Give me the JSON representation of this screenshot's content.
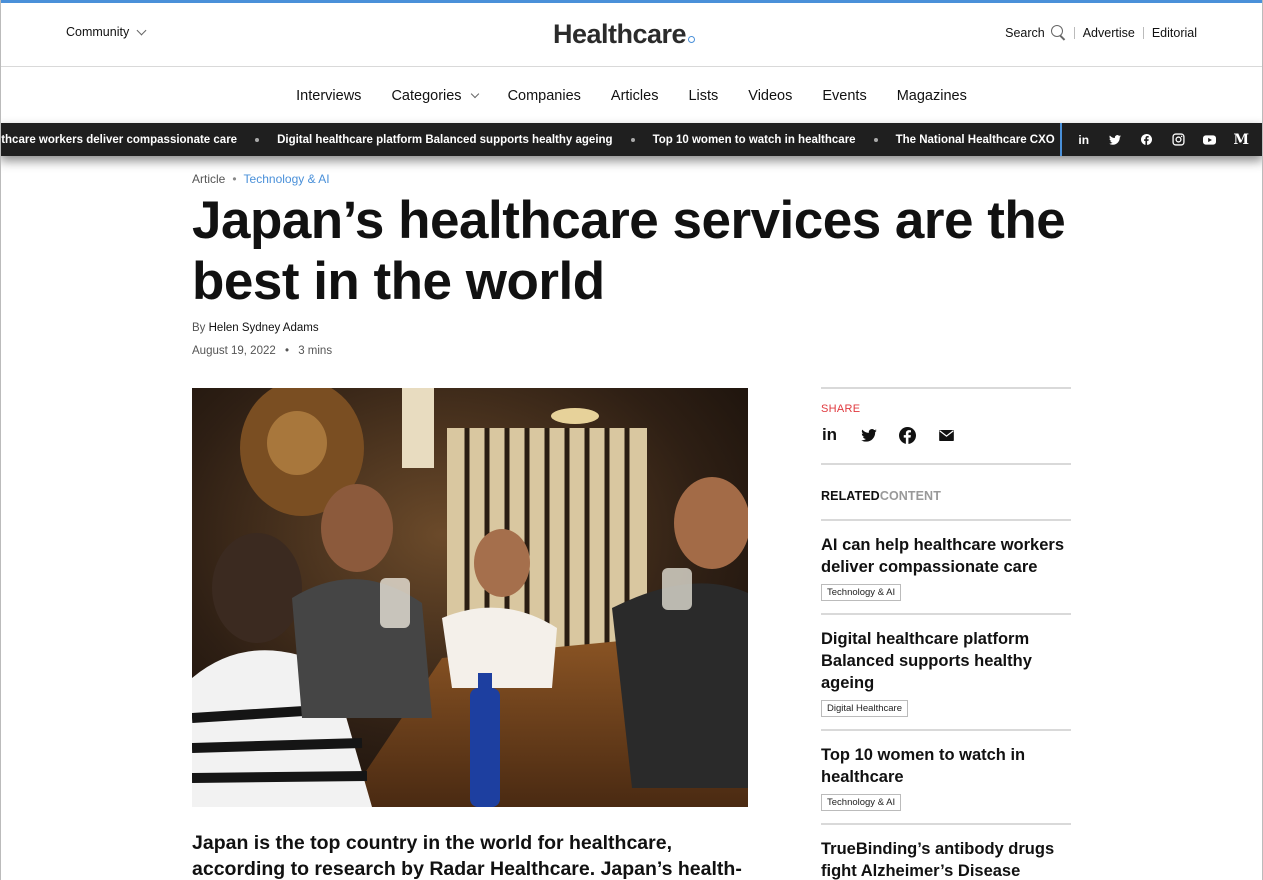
{
  "header": {
    "community_label": "Community",
    "logo_text": "Healthcare",
    "search_label": "Search",
    "advertise_label": "Advertise",
    "editorial_label": "Editorial"
  },
  "nav": {
    "items": [
      "Interviews",
      "Categories",
      "Companies",
      "Articles",
      "Lists",
      "Videos",
      "Events",
      "Magazines"
    ]
  },
  "ticker": {
    "items": [
      "lthcare workers deliver compassionate care",
      "Digital healthcare platform Balanced supports healthy ageing",
      "Top 10 women to watch in healthcare",
      "The National Healthcare CXO"
    ],
    "social": [
      "linkedin-icon",
      "twitter-icon",
      "facebook-icon",
      "instagram-icon",
      "youtube-icon",
      "medium-icon"
    ]
  },
  "article": {
    "type": "Article",
    "category": "Technology & AI",
    "title": "Japan’s healthcare services are the best in the world",
    "by_prefix": "By",
    "author": "Helen Sydney Adams",
    "date": "August 19, 2022",
    "read_time": "3 mins",
    "lede": "Japan is the top country in the world for healthcare, according to research by Radar Healthcare. Japan’s health-"
  },
  "sidebar": {
    "share_label": "SHARE",
    "related_bold": "RELATED",
    "related_gray": "CONTENT",
    "related": [
      {
        "title": "AI can help healthcare workers deliver compassionate care",
        "tag": "Technology & AI"
      },
      {
        "title": "Digital healthcare platform Balanced supports healthy ageing",
        "tag": "Digital Healthcare"
      },
      {
        "title": "Top 10 women to watch in healthcare",
        "tag": "Technology & AI"
      },
      {
        "title": "TrueBinding’s antibody drugs fight Alzheimer’s Disease",
        "tag": ""
      }
    ]
  },
  "colors": {
    "accent": "#4a90d9",
    "share": "#e0393e",
    "ticker_bg": "#1f1f1f"
  }
}
